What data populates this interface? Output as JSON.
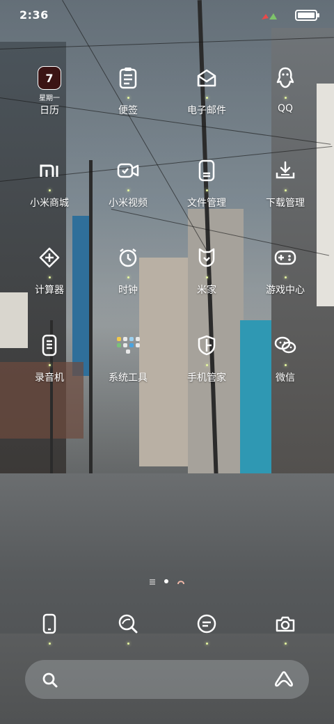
{
  "status_bar": {
    "time": "2:36",
    "battery_level": 0.95
  },
  "apps": [
    {
      "label": "日历",
      "icon": "calendar-icon",
      "tile_text": "7",
      "tile_subtitle": "星期一"
    },
    {
      "label": "便签",
      "icon": "notes-icon"
    },
    {
      "label": "电子邮件",
      "icon": "email-icon"
    },
    {
      "label": "QQ",
      "icon": "qq-icon"
    },
    {
      "label": "小米商城",
      "icon": "mi-store-icon"
    },
    {
      "label": "小米视频",
      "icon": "mi-video-icon"
    },
    {
      "label": "文件管理",
      "icon": "file-manager-icon"
    },
    {
      "label": "下载管理",
      "icon": "download-icon"
    },
    {
      "label": "计算器",
      "icon": "calculator-icon"
    },
    {
      "label": "时钟",
      "icon": "clock-icon"
    },
    {
      "label": "米家",
      "icon": "mijia-icon"
    },
    {
      "label": "游戏中心",
      "icon": "game-center-icon"
    },
    {
      "label": "录音机",
      "icon": "recorder-icon"
    },
    {
      "label": "系统工具",
      "icon": "system-tools-icon"
    },
    {
      "label": "手机管家",
      "icon": "security-icon"
    },
    {
      "label": "微信",
      "icon": "wechat-icon"
    }
  ],
  "pager": {
    "pages": 2,
    "current": 1
  },
  "dock": [
    {
      "icon": "phone-icon"
    },
    {
      "icon": "browser-icon"
    },
    {
      "icon": "messages-icon"
    },
    {
      "icon": "camera-icon"
    }
  ],
  "search_bar": {
    "left_icon": "search-icon",
    "right_icon": "assistant-icon"
  }
}
